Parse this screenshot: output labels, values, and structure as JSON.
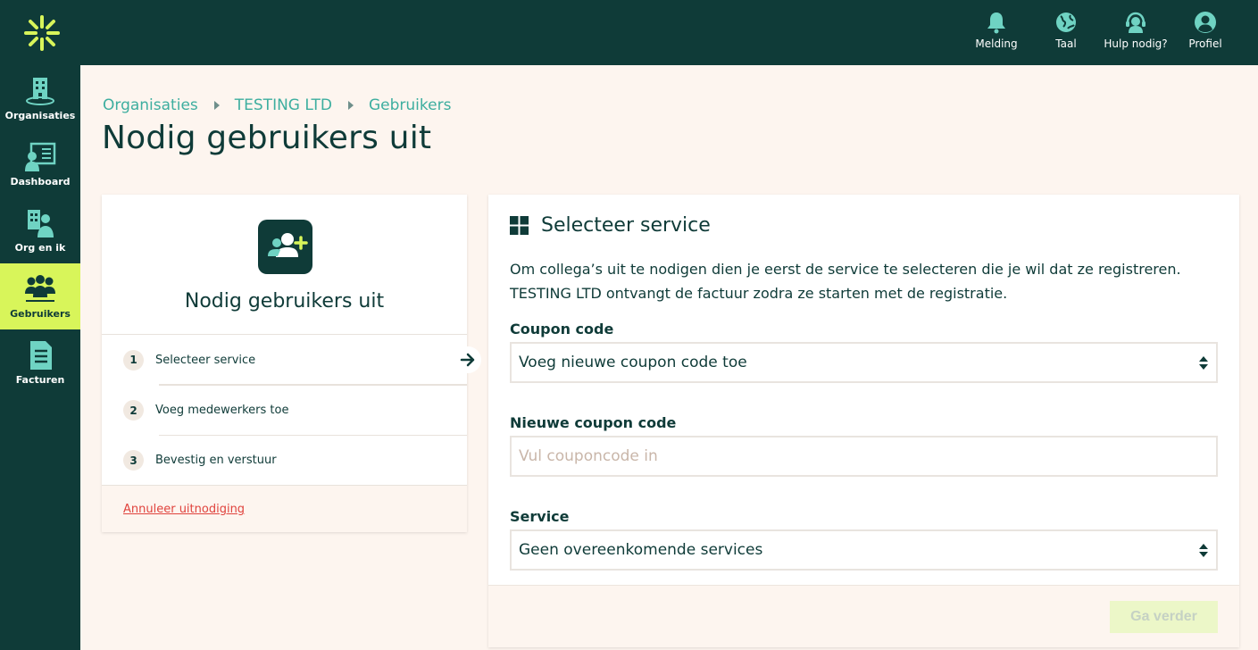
{
  "brand": {
    "accent": "#d8f55a",
    "primary": "#0f3b38",
    "teal": "#3dae9f",
    "danger": "#e0433d"
  },
  "topnav": {
    "items": [
      {
        "label": "Melding",
        "icon": "bell-icon"
      },
      {
        "label": "Taal",
        "icon": "globe-icon"
      },
      {
        "label": "Hulp nodig?",
        "icon": "headset-icon"
      },
      {
        "label": "Profiel",
        "icon": "user-circle-icon"
      }
    ]
  },
  "sidebar": {
    "items": [
      {
        "label": "Organisaties",
        "icon": "building-icon"
      },
      {
        "label": "Dashboard",
        "icon": "dashboard-icon"
      },
      {
        "label": "Org en ik",
        "icon": "org-person-icon"
      },
      {
        "label": "Gebruikers",
        "icon": "users-icon",
        "active": true
      },
      {
        "label": "Facturen",
        "icon": "invoice-icon"
      }
    ]
  },
  "breadcrumb": [
    "Organisaties",
    "TESTING LTD",
    "Gebruikers"
  ],
  "page_title": "Nodig gebruikers uit",
  "steps_card": {
    "title": "Nodig gebruikers uit",
    "steps": [
      {
        "num": "1",
        "label": "Selecteer service"
      },
      {
        "num": "2",
        "label": "Voeg medewerkers toe"
      },
      {
        "num": "3",
        "label": "Bevestig en verstuur"
      }
    ],
    "cancel_label": "Annuleer uitnodiging"
  },
  "service_card": {
    "title": "Selecteer service",
    "intro_line1": "Om collega’s uit te nodigen dien je eerst de service te selecteren die je wil dat ze registreren.",
    "intro_line2": "TESTING LTD ontvangt de factuur zodra ze starten met de registratie.",
    "coupon_label": "Coupon code",
    "coupon_value": "Voeg nieuwe coupon code toe",
    "new_coupon_label": "Nieuwe coupon code",
    "new_coupon_placeholder": "Vul couponcode in",
    "service_label": "Service",
    "service_value": "Geen overeenkomende services",
    "next_label": "Ga verder"
  }
}
